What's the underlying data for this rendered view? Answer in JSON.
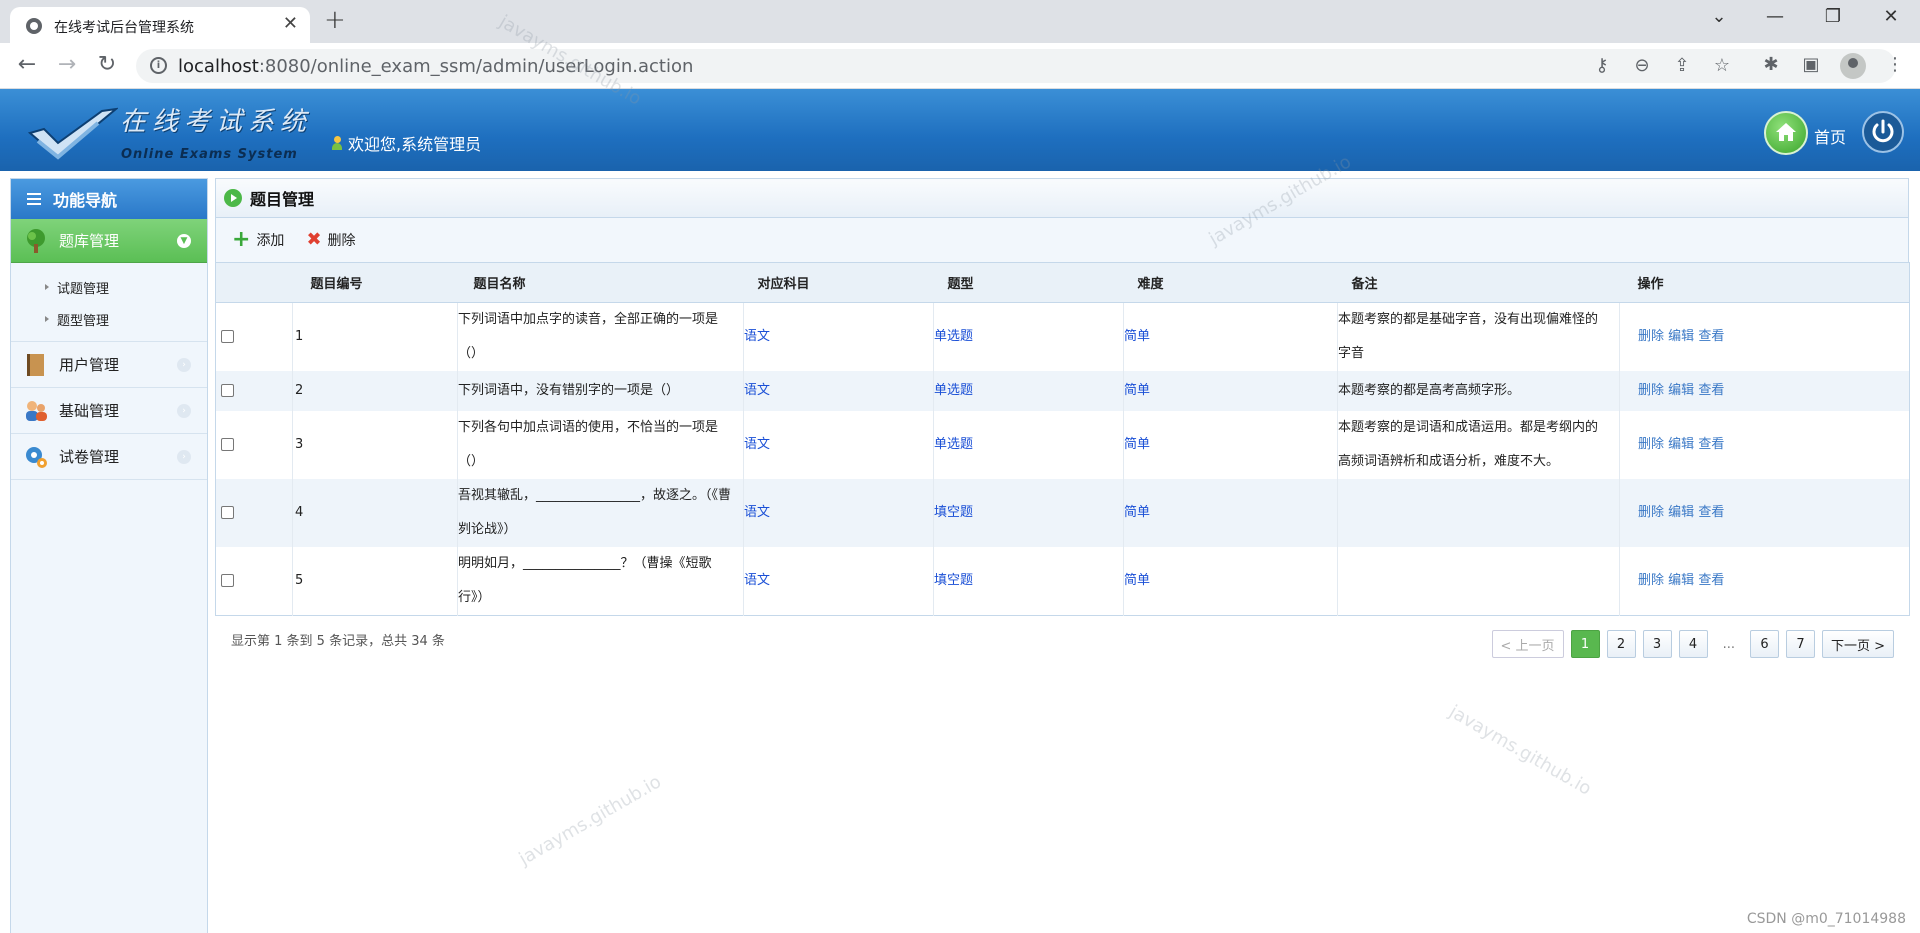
{
  "browser": {
    "tab_title": "在线考试后台管理系统",
    "url_host": "localhost",
    "url_rest": ":8080/online_exam_ssm/admin/userLogin.action"
  },
  "header": {
    "logo_cn": "在线考试系统",
    "logo_en": "Online Exams System",
    "welcome": "欢迎您,系统管理员",
    "home_label": "首页"
  },
  "sidebar": {
    "title": "功能导航",
    "active_group": "题库管理",
    "sub_items": [
      "试题管理",
      "题型管理"
    ],
    "groups": [
      "用户管理",
      "基础管理",
      "试卷管理"
    ]
  },
  "panel": {
    "title": "题目管理",
    "add_label": "添加",
    "delete_label": "删除"
  },
  "table": {
    "headers": [
      "题目编号",
      "题目名称",
      "对应科目",
      "题型",
      "难度",
      "备注",
      "操作"
    ],
    "rows": [
      {
        "id": "1",
        "name": "下列词语中加点字的读音，全部正确的一项是（）",
        "subject": "语文",
        "type": "单选题",
        "difficulty": "简单",
        "note": "本题考察的都是基础字音，没有出现偏难怪的字音"
      },
      {
        "id": "2",
        "name": "下列词语中，没有错别字的一项是（）",
        "subject": "语文",
        "type": "单选题",
        "difficulty": "简单",
        "note": "本题考察的都是高考高频字形。"
      },
      {
        "id": "3",
        "name": "下列各句中加点词语的使用，不恰当的一项是（）",
        "subject": "语文",
        "type": "单选题",
        "difficulty": "简单",
        "note": "本题考察的是词语和成语运用。都是考纲内的高频词语辨析和成语分析，难度不大。"
      },
      {
        "id": "4",
        "name": "吾视其辙乱，________________，故逐之。（《曹刿论战》）",
        "subject": "语文",
        "type": "填空题",
        "difficulty": "简单",
        "note": ""
      },
      {
        "id": "5",
        "name": "明明如月，_______________？（曹操《短歌行》）",
        "subject": "语文",
        "type": "填空题",
        "difficulty": "简单",
        "note": ""
      }
    ],
    "ops": {
      "delete": "删除",
      "edit": "编辑",
      "view": "查看"
    }
  },
  "footer": {
    "summary": "显示第 1 条到 5 条记录，总共 34 条",
    "prev": "< 上一页",
    "pages": [
      "1",
      "2",
      "3",
      "4",
      "...",
      "6",
      "7"
    ],
    "current_page": "1",
    "next": "下一页 >"
  },
  "watermark": "javayms.github.io",
  "credit": "CSDN @m0_71014988",
  "colors": {
    "header_blue": "#1e6fbf",
    "active_green": "#5bbf55",
    "link_blue": "#1a4fd6"
  }
}
